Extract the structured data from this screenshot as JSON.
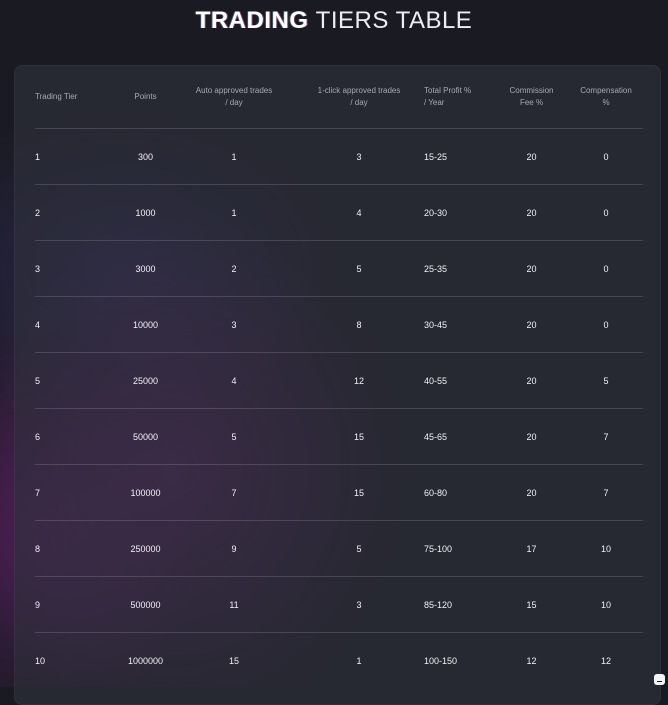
{
  "title": {
    "bold": "TRADING",
    "light": "TIERS TABLE"
  },
  "table": {
    "headers": {
      "tier": "Trading Tier",
      "points": "Points",
      "auto_line1": "Auto approved trades",
      "auto_line2": "/ day",
      "click_line1": "1-click approved trades",
      "click_line2": "/ day",
      "profit_line1": "Total Profit %",
      "profit_line2": "/ Year",
      "commission_line1": "Commission",
      "commission_line2": "Fee %",
      "compensation_line1": "Compensation",
      "compensation_line2": "%"
    },
    "rows": [
      {
        "tier": "1",
        "points": "300",
        "auto": "1",
        "click": "3",
        "profit": "15-25",
        "commission": "20",
        "compensation": "0"
      },
      {
        "tier": "2",
        "points": "1000",
        "auto": "1",
        "click": "4",
        "profit": "20-30",
        "commission": "20",
        "compensation": "0"
      },
      {
        "tier": "3",
        "points": "3000",
        "auto": "2",
        "click": "5",
        "profit": "25-35",
        "commission": "20",
        "compensation": "0"
      },
      {
        "tier": "4",
        "points": "10000",
        "auto": "3",
        "click": "8",
        "profit": "30-45",
        "commission": "20",
        "compensation": "0"
      },
      {
        "tier": "5",
        "points": "25000",
        "auto": "4",
        "click": "12",
        "profit": "40-55",
        "commission": "20",
        "compensation": "5"
      },
      {
        "tier": "6",
        "points": "50000",
        "auto": "5",
        "click": "15",
        "profit": "45-65",
        "commission": "20",
        "compensation": "7"
      },
      {
        "tier": "7",
        "points": "100000",
        "auto": "7",
        "click": "15",
        "profit": "60-80",
        "commission": "20",
        "compensation": "7"
      },
      {
        "tier": "8",
        "points": "250000",
        "auto": "9",
        "click": "5",
        "profit": "75-100",
        "commission": "17",
        "compensation": "10"
      },
      {
        "tier": "9",
        "points": "500000",
        "auto": "11",
        "click": "3",
        "profit": "85-120",
        "commission": "15",
        "compensation": "10"
      },
      {
        "tier": "10",
        "points": "1000000",
        "auto": "15",
        "click": "1",
        "profit": "100-150",
        "commission": "12",
        "compensation": "12"
      }
    ]
  },
  "widgets": {
    "chat_icon": "chat-bubble-icon"
  },
  "colors": {
    "background": "#1a1b22",
    "panel": "#2e303c",
    "purple_glow": "#782882",
    "header_text": "#a6a8b4"
  }
}
